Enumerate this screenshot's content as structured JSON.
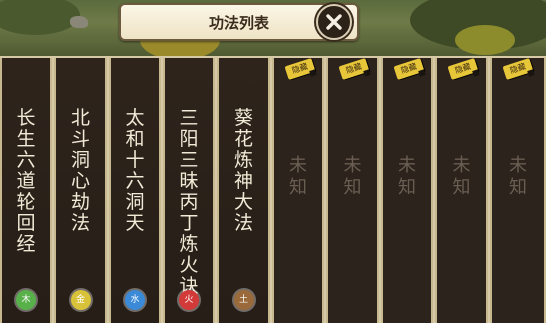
{
  "title": "功法列表",
  "columns": [
    {
      "name": "长生六道轮回经",
      "status": "learned",
      "element": "木",
      "element_color": "#58b04a"
    },
    {
      "name": "北斗洞心劫法",
      "status": "learned",
      "element": "金",
      "element_color": "#d8c23a"
    },
    {
      "name": "太和十六洞天",
      "status": "learned",
      "element": "水",
      "element_color": "#3a8ad8"
    },
    {
      "name": "三阳三昧丙丁炼火诀",
      "status": "learned",
      "element": "火",
      "element_color": "#d23a3a"
    },
    {
      "name": "葵花炼神大法",
      "status": "learned",
      "element": "土",
      "element_color": "#9a6a3a"
    },
    {
      "name": "未知",
      "status": "unknown",
      "tag": "隐藏"
    },
    {
      "name": "未知",
      "status": "unknown",
      "tag": "隐藏"
    },
    {
      "name": "未知",
      "status": "unknown",
      "tag": "隐藏"
    },
    {
      "name": "未知",
      "status": "unknown",
      "tag": "隐藏"
    },
    {
      "name": "未知",
      "status": "unknown",
      "tag": "隐藏"
    }
  ],
  "icons": {
    "close": "close-icon"
  }
}
